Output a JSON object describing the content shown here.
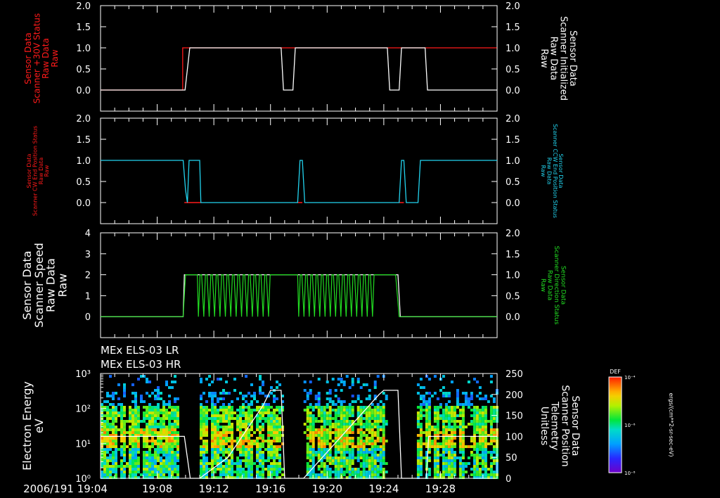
{
  "colors": {
    "background": "#000000",
    "axes": "#ffffff",
    "red": "#ff1a1a",
    "cyan": "#22d3ee",
    "green": "#22dd22",
    "white": "#ffffff"
  },
  "time_axis": {
    "x_range_minutes": [
      19.0667,
      19.5333
    ],
    "ticks": [
      {
        "label": "2006/191 19:04",
        "t": "19:04"
      },
      {
        "label": "19:08",
        "t": "19:08"
      },
      {
        "label": "19:12",
        "t": "19:12"
      },
      {
        "label": "19:16",
        "t": "19:16"
      },
      {
        "label": "19:20",
        "t": "19:20"
      },
      {
        "label": "19:24",
        "t": "19:24"
      },
      {
        "label": "19:28",
        "t": "19:28"
      }
    ]
  },
  "chart_data": [
    {
      "type": "line",
      "panel": 1,
      "left_axis": {
        "label_lines": [
          "Sensor Data",
          "Scanner +30V Status",
          "Raw Data",
          "Raw"
        ],
        "color": "red",
        "ylim": [
          -0.5,
          2.0
        ],
        "ticks": [
          "0.0",
          "0.5",
          "1.0",
          "1.5",
          "2.0"
        ]
      },
      "right_axis": {
        "label_lines": [
          "Sensor Data",
          "Scanner Initialized",
          "Raw Data",
          "Raw"
        ],
        "color": "white",
        "ylim": [
          -0.5,
          2.0
        ],
        "ticks": [
          "0.0",
          "0.5",
          "1.0",
          "1.5",
          "2.0"
        ]
      },
      "series": [
        {
          "color": "red",
          "x": [
            "19:04:00",
            "19:09:48",
            "19:09:48",
            "19:16:45",
            "19:16:45",
            "19:24:15",
            "19:24:15",
            "19:31:59"
          ],
          "y": [
            0,
            0,
            1,
            1,
            1,
            1,
            1,
            1
          ]
        },
        {
          "color": "white",
          "x": [
            "19:04:00",
            "19:09:58",
            "19:10:18",
            "19:16:45",
            "19:16:55",
            "19:17:35",
            "19:17:45",
            "19:24:15",
            "19:24:25",
            "19:25:05",
            "19:25:15",
            "19:26:55",
            "19:27:05",
            "19:32:00"
          ],
          "y": [
            0,
            0,
            1,
            1,
            0,
            0,
            1,
            1,
            0,
            0,
            1,
            1,
            0,
            0
          ]
        }
      ]
    },
    {
      "type": "line",
      "panel": 2,
      "left_axis": {
        "label_lines": [
          "Sensor Data",
          "Scanner CW End Position Status",
          "Raw Data",
          "Raw"
        ],
        "color": "red",
        "ylim": [
          -0.5,
          2.0
        ],
        "ticks": [
          "0.0",
          "0.5",
          "1.0",
          "1.5",
          "2.0"
        ]
      },
      "right_axis": {
        "label_lines": [
          "Sensor Data",
          "Scanner CCW End Position Status",
          "Raw Data",
          "Raw"
        ],
        "color": "cyan",
        "ylim": [
          -0.5,
          2.0
        ],
        "ticks": [
          "0.0",
          "0.5",
          "1.0",
          "1.5",
          "2.0"
        ]
      },
      "series": [
        {
          "color": "red",
          "x": [
            "19:09:55",
            "19:11:05",
            "19:17:55",
            "19:18:15",
            "19:25:05",
            "19:25:25"
          ],
          "y": [
            0,
            0,
            0,
            0,
            0,
            0
          ],
          "segments": true
        },
        {
          "color": "cyan",
          "x": [
            "19:04:00",
            "19:09:50",
            "19:10:00",
            "19:10:08",
            "19:10:15",
            "19:11:00",
            "19:11:05",
            "19:17:55",
            "19:18:05",
            "19:18:15",
            "19:18:25",
            "19:25:05",
            "19:25:15",
            "19:25:25",
            "19:25:35",
            "19:26:25",
            "19:26:35",
            "19:32:00"
          ],
          "y": [
            1,
            1,
            0.3,
            0,
            1,
            1,
            0,
            0,
            1,
            1,
            0,
            0,
            1,
            1,
            0,
            0,
            1,
            1
          ]
        }
      ]
    },
    {
      "type": "line",
      "panel": 3,
      "left_axis": {
        "label_lines": [
          "Sensor Data",
          "Scanner Speed",
          "Raw Data",
          "Raw"
        ],
        "color": "white",
        "ylim": [
          -1,
          4
        ],
        "ticks": [
          "0",
          "1",
          "2",
          "3",
          "4"
        ]
      },
      "right_axis": {
        "label_lines": [
          "Sensor Data",
          "Scanner Direction Status",
          "Raw Data",
          "Raw"
        ],
        "color": "green",
        "ylim": [
          -0.5,
          2.0
        ],
        "ticks": [
          "0.0",
          "0.5",
          "1.0",
          "1.5",
          "2.0"
        ]
      },
      "series": [
        {
          "color": "white",
          "x": [
            "19:04:00",
            "19:09:50",
            "19:09:55",
            "19:25:00",
            "19:25:10",
            "19:32:00"
          ],
          "y": [
            0,
            0,
            2,
            2,
            0,
            0
          ],
          "axis": "left"
        },
        {
          "color": "green",
          "axis": "right",
          "pattern": "scanner_direction"
        }
      ]
    },
    {
      "type": "heatmap",
      "panel": 4,
      "titles": [
        "MEx ELS-03 LR",
        "MEx ELS-03 HR"
      ],
      "left_axis": {
        "label_lines": [
          "Electron Energy",
          "eV"
        ],
        "scale": "log",
        "ylim": [
          1,
          1000
        ],
        "ticks": [
          "10⁰",
          "10¹",
          "10²",
          "10³"
        ]
      },
      "right_axis": {
        "label_lines": [
          "Sensor Data",
          "Scanner Position",
          "Telemetry",
          "Unitless"
        ],
        "ylim": [
          0,
          250
        ],
        "ticks": [
          "0",
          "50",
          "100",
          "150",
          "200",
          "250"
        ]
      },
      "colorbar": {
        "title": "DEF",
        "scale": "log",
        "ticks": [
          "10⁻⁸",
          "10⁻⁶",
          "10⁻⁴"
        ],
        "units": "ergs/(cm**2-sr-sec-eV)"
      },
      "data_blocks": [
        {
          "start": "19:04:00",
          "end": "19:09:30"
        },
        {
          "start": "19:11:00",
          "end": "19:17:00"
        },
        {
          "start": "19:18:20",
          "end": "19:24:20"
        },
        {
          "start": "19:26:20",
          "end": "19:32:00"
        }
      ],
      "scanner_position": {
        "x": [
          "19:04:00",
          "19:09:55",
          "19:10:20",
          "19:11:00",
          "19:13:00",
          "19:15:30",
          "19:16:00",
          "19:16:45",
          "19:17:00",
          "19:17:35",
          "19:18:20",
          "19:21:00",
          "19:23:40",
          "19:24:00",
          "19:25:00",
          "19:25:15",
          "19:26:10",
          "19:27:00",
          "19:27:10",
          "19:32:00"
        ],
        "y": [
          100,
          100,
          0,
          0,
          50,
          175,
          210,
          210,
          0,
          0,
          0,
          100,
          200,
          210,
          210,
          0,
          0,
          0,
          100,
          100
        ]
      }
    }
  ]
}
